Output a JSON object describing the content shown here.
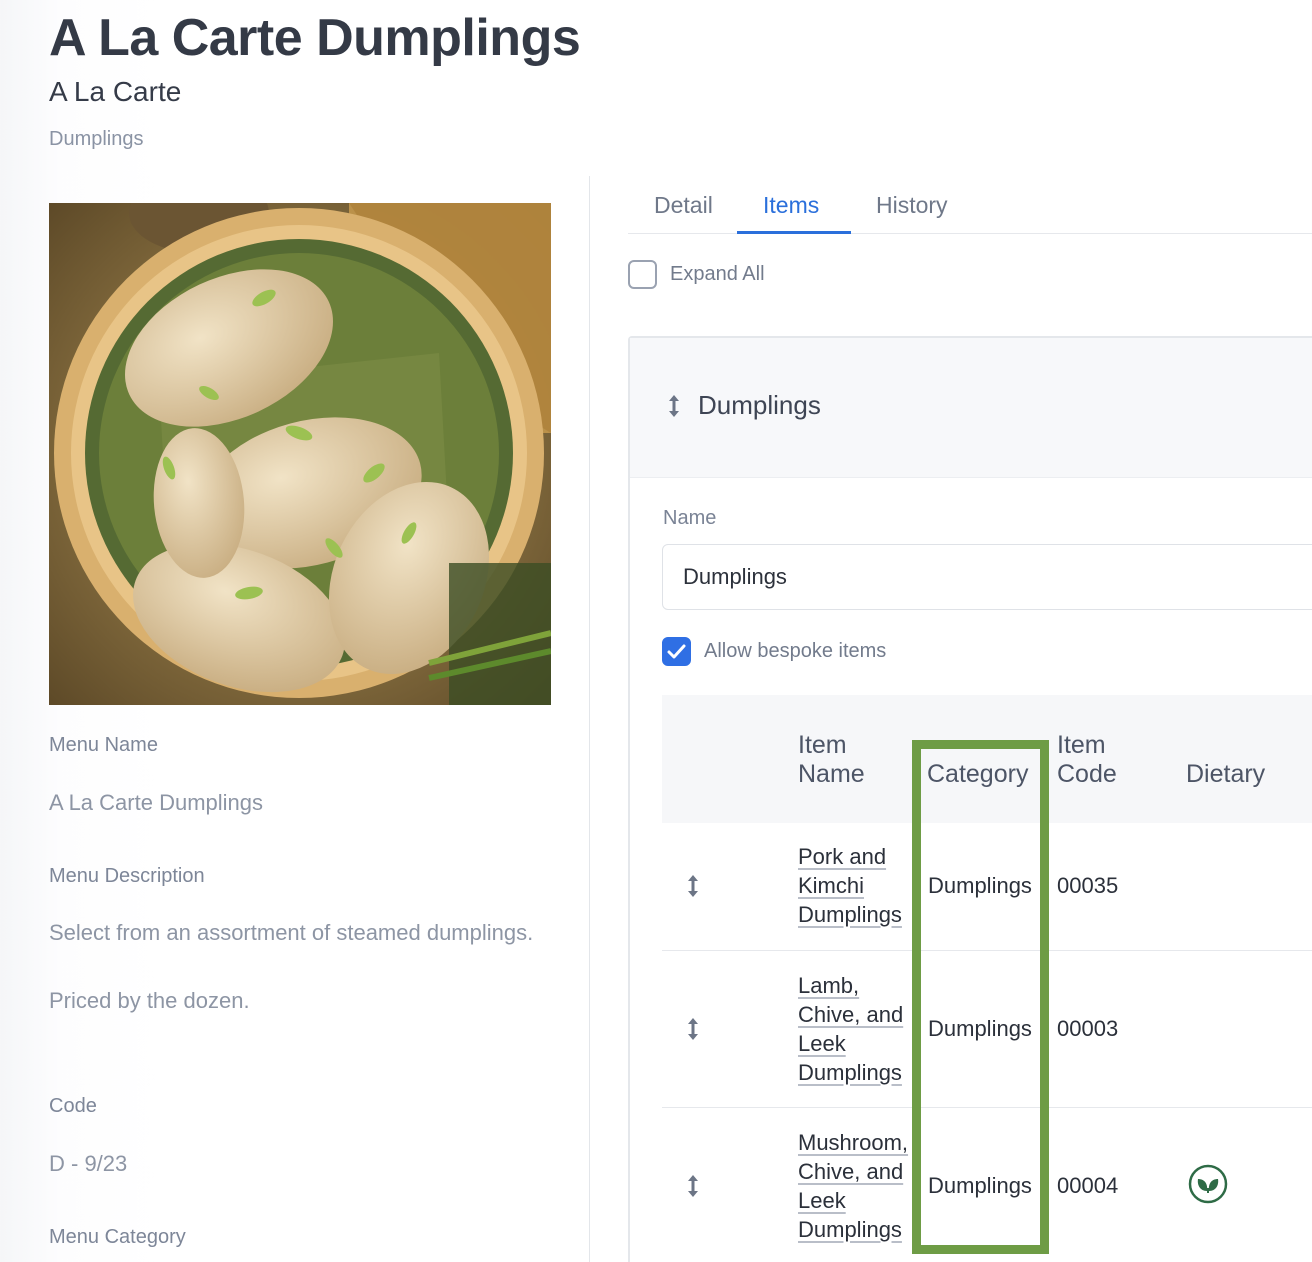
{
  "header": {
    "title": "A La Carte Dumplings",
    "subtitle": "A La Carte",
    "crumb": "Dumplings"
  },
  "details": {
    "menu_name_label": "Menu Name",
    "menu_name_value": "A La Carte Dumplings",
    "menu_description_label": "Menu Description",
    "menu_description_line1": "Select from an assortment of steamed dumplings.",
    "menu_description_line2": "Priced by the dozen.",
    "code_label": "Code",
    "code_value": "D - 9/23",
    "menu_category_label": "Menu Category"
  },
  "tabs": [
    {
      "label": "Detail",
      "active": false
    },
    {
      "label": "Items",
      "active": true
    },
    {
      "label": "History",
      "active": false
    }
  ],
  "expand_all": {
    "label": "Expand All",
    "checked": false
  },
  "section": {
    "title": "Dumplings",
    "name_label": "Name",
    "name_value": "Dumplings",
    "bespoke_label": "Allow bespoke items",
    "bespoke_checked": true
  },
  "table": {
    "headers": {
      "item_name_1": "Item",
      "item_name_2": "Name",
      "category": "Category",
      "item_code_1": "Item",
      "item_code_2": "Code",
      "dietary": "Dietary"
    },
    "rows": [
      {
        "name_lines": [
          "Pork and",
          "Kimchi",
          "Dumplings"
        ],
        "category": "Dumplings",
        "code": "00035",
        "dietary": ""
      },
      {
        "name_lines": [
          "Lamb,",
          "Chive, and",
          "Leek",
          "Dumplings"
        ],
        "category": "Dumplings",
        "code": "00003",
        "dietary": ""
      },
      {
        "name_lines": [
          "Mushroom,",
          "Chive, and",
          "Leek",
          "Dumplings"
        ],
        "category": "Dumplings",
        "code": "00004",
        "dietary": "vegan-leaf-icon"
      }
    ]
  },
  "colors": {
    "accent": "#2a6fdb",
    "highlight": "#6e9c45",
    "vegan": "#2e6b46"
  }
}
